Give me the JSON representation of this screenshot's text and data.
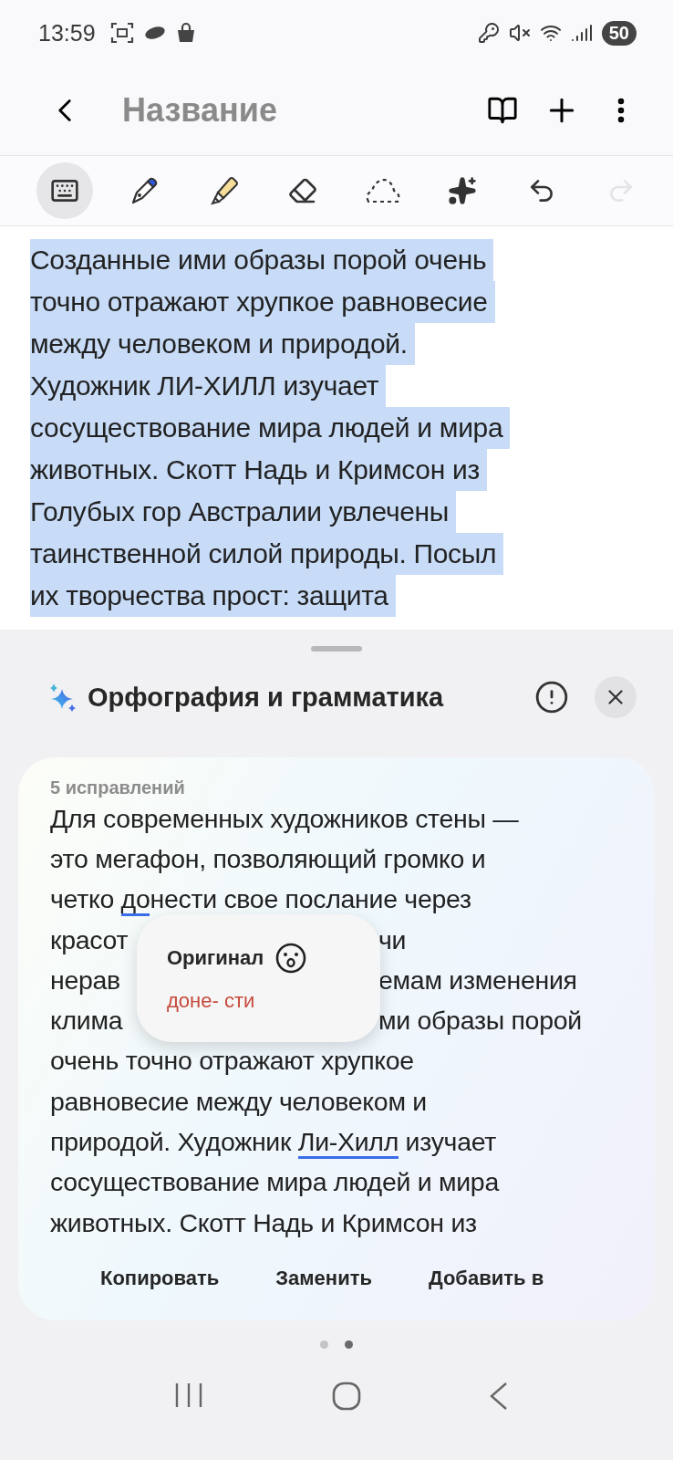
{
  "status_bar": {
    "time": "13:59",
    "battery": "50"
  },
  "header": {
    "title": "Название"
  },
  "toolbar": [
    {
      "kind": "keyboard",
      "selected": true,
      "disabled": false
    },
    {
      "kind": "pen",
      "selected": false,
      "disabled": false
    },
    {
      "kind": "highlighter",
      "selected": false,
      "disabled": false
    },
    {
      "kind": "eraser",
      "selected": false,
      "disabled": false
    },
    {
      "kind": "lasso",
      "selected": false,
      "disabled": false
    },
    {
      "kind": "ai",
      "selected": false,
      "disabled": false
    },
    {
      "kind": "undo",
      "selected": false,
      "disabled": false
    },
    {
      "kind": "redo",
      "selected": false,
      "disabled": true
    }
  ],
  "note_lines": [
    "Созданные ими образы порой очень",
    "точно отражают хрупкое равновесие",
    "между человеком и природой.",
    "Художник ЛИ-ХИЛЛ изучает",
    "сосуществование мира людей и мира",
    "животных. Скотт Надь и Кримсон из",
    "Голубых гор Австралии увлечены",
    "таинственной силой природы. Посыл",
    "их творчества прост: защита"
  ],
  "sheet": {
    "title": "Орфография и грамматика",
    "card": {
      "count": "5 исправлений",
      "lines": [
        {
          "left": [
            {
              "text": "Для современных художников стены —",
              "marked": false
            }
          ]
        },
        {
          "left": [
            {
              "text": "это мегафон, позволяющий громко и",
              "marked": false
            }
          ]
        },
        {
          "left": [
            {
              "text": "четко ",
              "marked": false
            },
            {
              "text": "до",
              "marked": true
            },
            {
              "text": "нести свое послание через",
              "marked": false
            }
          ]
        },
        {
          "left": [
            {
              "text": "красот",
              "marked": false
            }
          ],
          "right": "чи"
        },
        {
          "left": [
            {
              "text": "нерав",
              "marked": false
            }
          ],
          "right": "емам изменения"
        },
        {
          "left": [
            {
              "text": "клима",
              "marked": false
            }
          ],
          "right": "ми образы порой"
        },
        {
          "left": [
            {
              "text": "очень точно отражают хрупкое",
              "marked": false
            }
          ]
        },
        {
          "left": [
            {
              "text": "равновесие между человеком и",
              "marked": false
            }
          ]
        },
        {
          "left": [
            {
              "text": "природой. Художник ",
              "marked": false
            },
            {
              "text": "Ли-Хилл",
              "marked": true
            },
            {
              "text": " изучает",
              "marked": false
            }
          ]
        },
        {
          "left": [
            {
              "text": "сосуществование мира людей и мира",
              "marked": false
            }
          ]
        },
        {
          "left": [
            {
              "text": "животных. Скотт Надь и Кримсон из",
              "marked": false
            }
          ]
        }
      ],
      "popup": {
        "title": "Оригинал",
        "text": "доне- сти"
      },
      "actions": [
        "Копировать",
        "Заменить",
        "Добавить в"
      ]
    },
    "pages": [
      {
        "selected": false
      },
      {
        "selected": true
      }
    ]
  }
}
